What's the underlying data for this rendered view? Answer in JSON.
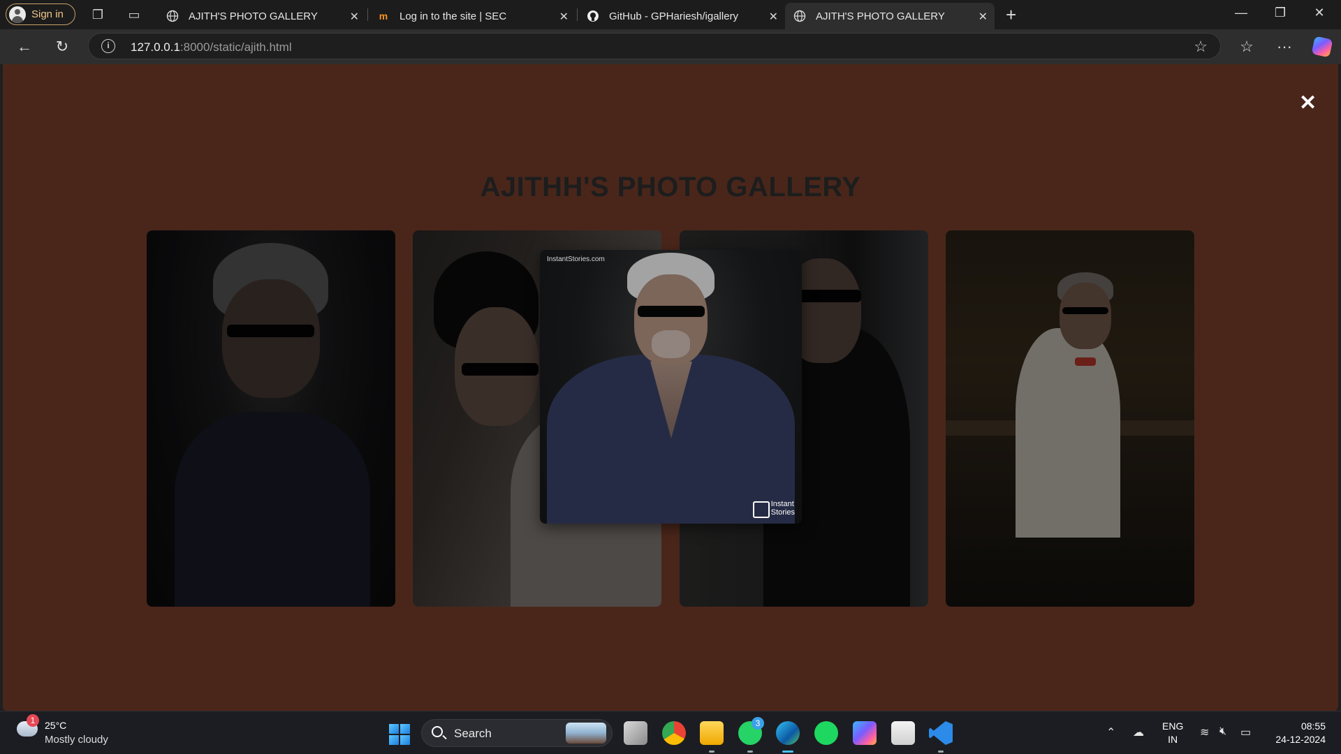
{
  "browser": {
    "signin_label": "Sign in",
    "tabs": [
      {
        "title": "AJITH'S PHOTO GALLERY",
        "icon": "globe-icon",
        "active": false
      },
      {
        "title": "Log in to the site | SEC",
        "icon": "moodle-icon",
        "active": false
      },
      {
        "title": "GitHub - GPHariesh/igallery",
        "icon": "github-icon",
        "active": false
      },
      {
        "title": "AJITH'S PHOTO GALLERY",
        "icon": "globe-icon",
        "active": true
      }
    ],
    "address": {
      "host": "127.0.0.1",
      "rest": ":8000/static/ajith.html"
    }
  },
  "page": {
    "title": "AJITHH'S PHOTO GALLERY",
    "close_label": "✕",
    "background": "#4a261a",
    "photos": [
      {
        "name": "photo-1"
      },
      {
        "name": "photo-2"
      },
      {
        "name": "photo-3"
      },
      {
        "name": "photo-4"
      }
    ],
    "featured": {
      "watermark": "InstantStories.com",
      "logo_line1": "Instant",
      "logo_line2": "Stories"
    }
  },
  "taskbar": {
    "weather_badge": "1",
    "temperature": "25°C",
    "condition": "Mostly cloudy",
    "search_label": "Search",
    "whatsapp_badge": "3",
    "lang_line1": "ENG",
    "lang_line2": "IN",
    "time": "08:55",
    "date": "24-12-2024"
  }
}
